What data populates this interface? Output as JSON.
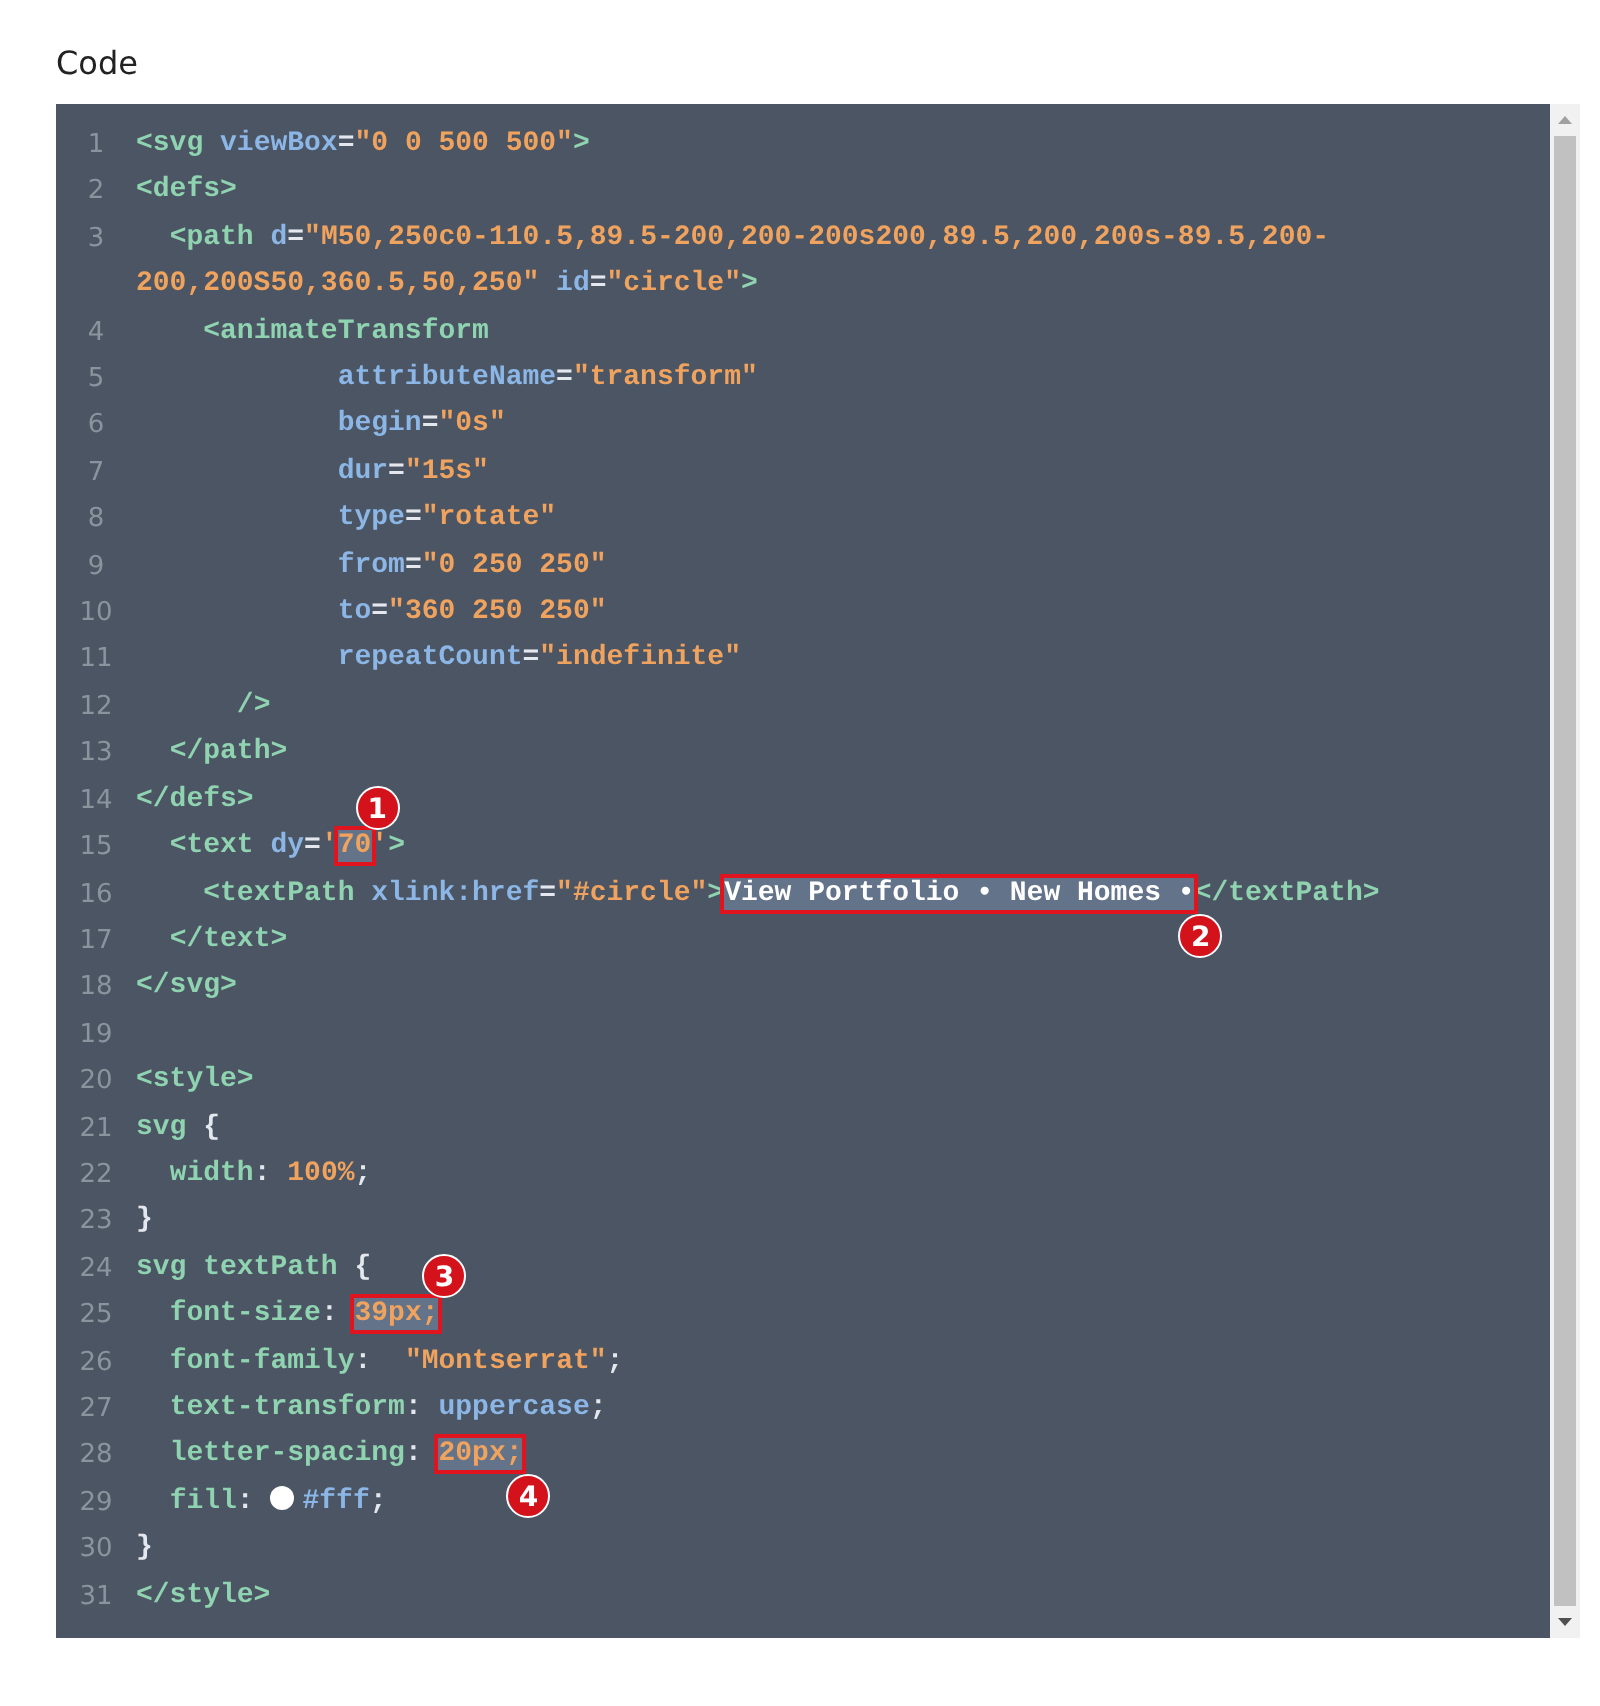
{
  "section_title": "Code",
  "code_lines": [
    {
      "number": "1",
      "tokens": [
        {
          "kind": "tag",
          "text": "<svg "
        },
        {
          "kind": "attr",
          "text": "viewBox"
        },
        {
          "kind": "punct",
          "text": "="
        },
        {
          "kind": "value",
          "text": "\"0 0 500 500\""
        },
        {
          "kind": "tag",
          "text": ">"
        }
      ]
    },
    {
      "number": "2",
      "tokens": [
        {
          "kind": "tag",
          "text": "<defs>"
        }
      ]
    },
    {
      "number": "3",
      "tokens": [
        {
          "kind": "tag",
          "text": "  <path "
        },
        {
          "kind": "attr",
          "text": "d"
        },
        {
          "kind": "punct",
          "text": "="
        },
        {
          "kind": "value",
          "text": "\"M50,250c0-110.5,89.5-200,200-200s200,89.5,200,200s-89.5,200-200,200S50,360.5,50,250\""
        },
        {
          "kind": "attr",
          "text": " id"
        },
        {
          "kind": "punct",
          "text": "="
        },
        {
          "kind": "value",
          "text": "\"circle\""
        },
        {
          "kind": "tag",
          "text": ">"
        }
      ]
    },
    {
      "number": "4",
      "tokens": [
        {
          "kind": "tag",
          "text": "    <animateTransform"
        }
      ]
    },
    {
      "number": "5",
      "tokens": [
        {
          "kind": "attr",
          "text": "            attributeName"
        },
        {
          "kind": "punct",
          "text": "="
        },
        {
          "kind": "value",
          "text": "\"transform\""
        }
      ]
    },
    {
      "number": "6",
      "tokens": [
        {
          "kind": "attr",
          "text": "            begin"
        },
        {
          "kind": "punct",
          "text": "="
        },
        {
          "kind": "value",
          "text": "\"0s\""
        }
      ]
    },
    {
      "number": "7",
      "tokens": [
        {
          "kind": "attr",
          "text": "            dur"
        },
        {
          "kind": "punct",
          "text": "="
        },
        {
          "kind": "value",
          "text": "\"15s\""
        }
      ]
    },
    {
      "number": "8",
      "tokens": [
        {
          "kind": "attr",
          "text": "            type"
        },
        {
          "kind": "punct",
          "text": "="
        },
        {
          "kind": "value",
          "text": "\"rotate\""
        }
      ]
    },
    {
      "number": "9",
      "tokens": [
        {
          "kind": "attr",
          "text": "            from"
        },
        {
          "kind": "punct",
          "text": "="
        },
        {
          "kind": "value",
          "text": "\"0 250 250\""
        }
      ]
    },
    {
      "number": "10",
      "tokens": [
        {
          "kind": "attr",
          "text": "            to"
        },
        {
          "kind": "punct",
          "text": "="
        },
        {
          "kind": "value",
          "text": "\"360 250 250\""
        }
      ]
    },
    {
      "number": "11",
      "tokens": [
        {
          "kind": "attr",
          "text": "            repeatCount"
        },
        {
          "kind": "punct",
          "text": "="
        },
        {
          "kind": "value",
          "text": "\"indefinite\""
        }
      ]
    },
    {
      "number": "12",
      "tokens": [
        {
          "kind": "tag",
          "text": "      />"
        }
      ]
    },
    {
      "number": "13",
      "tokens": [
        {
          "kind": "tag",
          "text": "  </path>"
        }
      ]
    },
    {
      "number": "14",
      "tokens": [
        {
          "kind": "tag",
          "text": "</defs>"
        }
      ]
    },
    {
      "number": "15",
      "tokens": [
        {
          "kind": "tag",
          "text": "  <text "
        },
        {
          "kind": "attr",
          "text": "dy"
        },
        {
          "kind": "punct",
          "text": "="
        },
        {
          "kind": "value",
          "text": "'"
        },
        {
          "kind": "value",
          "text": "70",
          "highlighted": true,
          "callout": "1"
        },
        {
          "kind": "value",
          "text": "'"
        },
        {
          "kind": "tag",
          "text": ">"
        }
      ]
    },
    {
      "number": "16",
      "tokens": [
        {
          "kind": "tag",
          "text": "    <textPath "
        },
        {
          "kind": "attr",
          "text": "xlink:href"
        },
        {
          "kind": "punct",
          "text": "="
        },
        {
          "kind": "value",
          "text": "\"#circle\""
        },
        {
          "kind": "tag",
          "text": ">"
        },
        {
          "kind": "content",
          "text": "View Portfolio • New Homes •",
          "highlighted": true,
          "callout": "2"
        },
        {
          "kind": "tag",
          "text": "</textPath>"
        }
      ]
    },
    {
      "number": "17",
      "tokens": [
        {
          "kind": "tag",
          "text": "  </text>"
        }
      ]
    },
    {
      "number": "18",
      "tokens": [
        {
          "kind": "tag",
          "text": "</svg>"
        }
      ]
    },
    {
      "number": "19"
    },
    {
      "number": "20",
      "tokens": [
        {
          "kind": "tag",
          "text": "<style>"
        }
      ]
    },
    {
      "number": "21",
      "tokens": [
        {
          "kind": "tag",
          "text": "svg "
        },
        {
          "kind": "punct",
          "text": "{"
        }
      ]
    },
    {
      "number": "22",
      "tokens": [
        {
          "kind": "tag",
          "text": "  width"
        },
        {
          "kind": "punct",
          "text": ": "
        },
        {
          "kind": "value",
          "text": "100%"
        },
        {
          "kind": "punct",
          "text": ";"
        }
      ]
    },
    {
      "number": "23",
      "tokens": [
        {
          "kind": "punct",
          "text": "}"
        }
      ]
    },
    {
      "number": "24",
      "tokens": [
        {
          "kind": "tag",
          "text": "svg textPath "
        },
        {
          "kind": "punct",
          "text": "{"
        }
      ]
    },
    {
      "number": "25",
      "tokens": [
        {
          "kind": "tag",
          "text": "  font-size"
        },
        {
          "kind": "punct",
          "text": ": "
        },
        {
          "kind": "value",
          "text": "39px;",
          "highlighted": true,
          "callout": "3"
        }
      ]
    },
    {
      "number": "26",
      "tokens": [
        {
          "kind": "tag",
          "text": "  font-family"
        },
        {
          "kind": "punct",
          "text": ":  "
        },
        {
          "kind": "value",
          "text": "\"Montserrat\""
        },
        {
          "kind": "punct",
          "text": ";"
        }
      ]
    },
    {
      "number": "27",
      "tokens": [
        {
          "kind": "tag",
          "text": "  text-transform"
        },
        {
          "kind": "punct",
          "text": ": "
        },
        {
          "kind": "attr",
          "text": "uppercase"
        },
        {
          "kind": "punct",
          "text": ";"
        }
      ]
    },
    {
      "number": "28",
      "tokens": [
        {
          "kind": "tag",
          "text": "  letter-spacing"
        },
        {
          "kind": "punct",
          "text": ": "
        },
        {
          "kind": "value",
          "text": "20px;",
          "highlighted": true,
          "callout": "4"
        }
      ]
    },
    {
      "number": "29",
      "tokens": [
        {
          "kind": "tag",
          "text": "  fill"
        },
        {
          "kind": "punct",
          "text": ": "
        },
        {
          "kind": "swatch"
        },
        {
          "kind": "attr",
          "text": "#fff"
        },
        {
          "kind": "punct",
          "text": ";"
        }
      ]
    },
    {
      "number": "30",
      "tokens": [
        {
          "kind": "punct",
          "text": "}"
        }
      ]
    },
    {
      "number": "31",
      "tokens": [
        {
          "kind": "tag",
          "text": "</style>"
        }
      ]
    }
  ]
}
